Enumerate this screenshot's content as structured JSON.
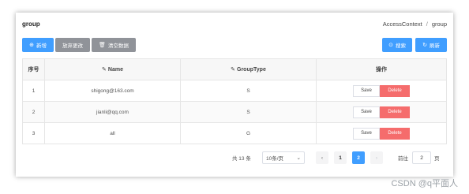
{
  "page": {
    "title": "group"
  },
  "breadcrumb": {
    "root": "AccessContext",
    "separator": "/",
    "current": "group"
  },
  "toolbar": {
    "add_label": "新增",
    "discard_label": "放弃更改",
    "clear_label": "清空数据",
    "search_label": "搜索",
    "refresh_label": "刷新"
  },
  "table": {
    "columns": {
      "index": "序号",
      "name": "Name",
      "group_type": "GroupType",
      "actions": "操作"
    },
    "rows": [
      {
        "index": "1",
        "name": "shigong@163.com",
        "group_type": "S"
      },
      {
        "index": "2",
        "name": "jianli@qq.com",
        "group_type": "S"
      },
      {
        "index": "3",
        "name": "all",
        "group_type": "G"
      }
    ],
    "save_label": "Save",
    "delete_label": "Delete"
  },
  "pagination": {
    "total_text": "共 13 条",
    "page_size": "10条/页",
    "pages": [
      "1",
      "2"
    ],
    "current_page": "2",
    "jump_label": "前往",
    "jump_value": "2",
    "page_suffix": "页"
  },
  "watermark": "CSDN @q平面人",
  "colors": {
    "primary": "#409eff",
    "danger": "#f56c6c",
    "gray_button": "#909399"
  }
}
